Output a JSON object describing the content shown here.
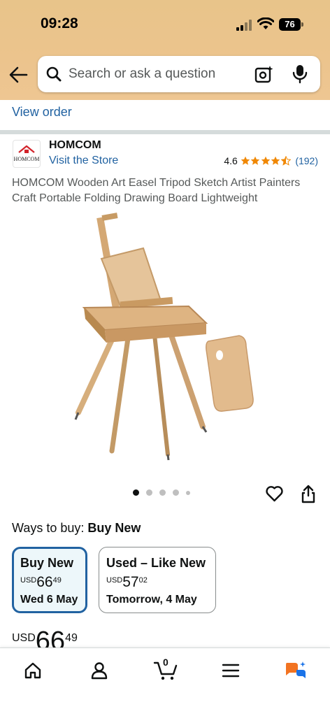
{
  "status_bar": {
    "time": "09:28",
    "battery": "76"
  },
  "search": {
    "placeholder": "Search or ask a question"
  },
  "order": {
    "view_order_label": "View order"
  },
  "brand": {
    "name": "HOMCOM",
    "visit_store_label": "Visit the Store",
    "logo_text": "HOMCOM"
  },
  "rating": {
    "value": "4.6",
    "stars": 4.5,
    "count": "(192)"
  },
  "product": {
    "title": "HOMCOM Wooden Art Easel Tripod Sketch Artist Painters Craft Portable Folding Drawing Board Lightweight",
    "image_icon": "easel-image",
    "image_count": 5,
    "active_image": 0
  },
  "ways_to_buy": {
    "label": "Ways to buy:",
    "selected": "Buy New"
  },
  "options": [
    {
      "title": "Buy New",
      "currency": "USD",
      "whole": "66",
      "fraction": "49",
      "delivery": "Wed 6 May"
    },
    {
      "title": "Used – Like New",
      "currency": "USD",
      "whole": "57",
      "fraction": "02",
      "delivery": "Tomorrow, 4 May"
    }
  ],
  "price": {
    "currency": "USD",
    "whole": "66",
    "fraction": "49"
  },
  "cart": {
    "count": "0"
  },
  "nav": {
    "items": [
      "home-icon",
      "account-icon",
      "cart-icon",
      "menu-icon",
      "rufus-icon"
    ]
  },
  "colors": {
    "header_bg": "#ecc48d",
    "link": "#2162a1",
    "star": "#f08804",
    "selected_border": "#2162a1",
    "selected_bg": "#edf7fa"
  }
}
